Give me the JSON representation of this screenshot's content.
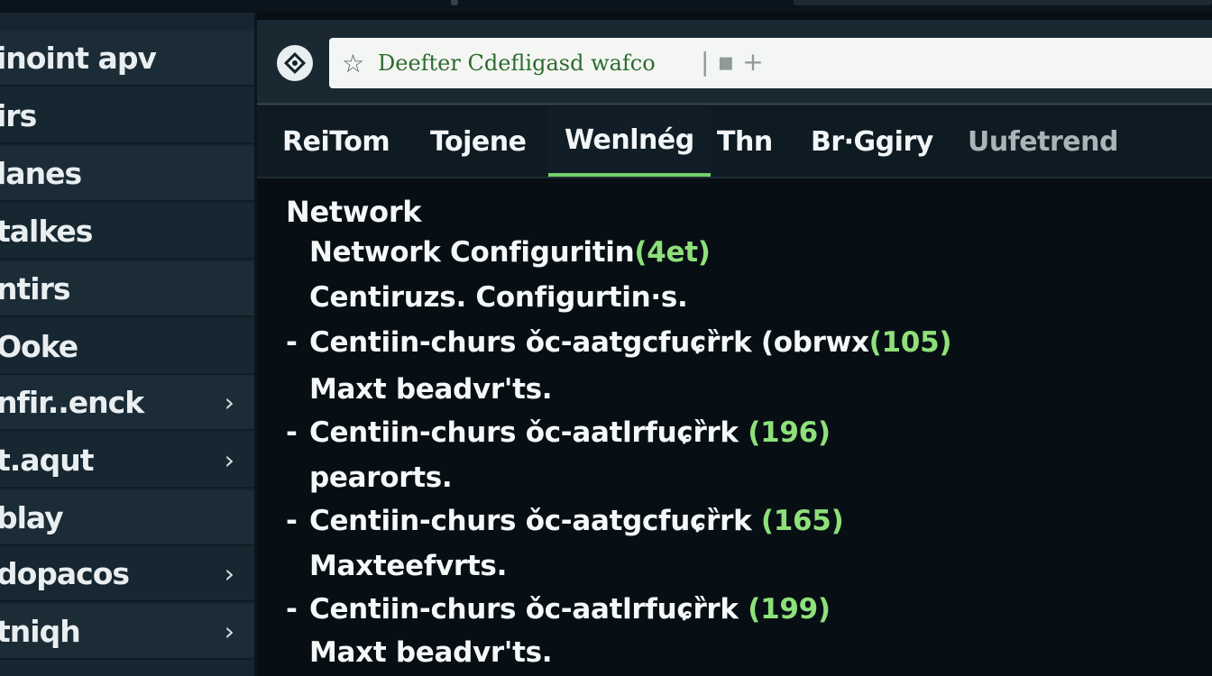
{
  "sidebar": {
    "items": [
      {
        "label": "inoint apv",
        "chevron": false
      },
      {
        "label": "irs",
        "chevron": false
      },
      {
        "label": "lanes",
        "chevron": false
      },
      {
        "label": "talkes",
        "chevron": false
      },
      {
        "label": "ntirs",
        "chevron": false
      },
      {
        "label": "Ooke",
        "chevron": false
      },
      {
        "label": "nfir..enck",
        "chevron": true
      },
      {
        "label": "t.aqut",
        "chevron": true
      },
      {
        "label": "blay",
        "chevron": false
      },
      {
        "label": "dopacos",
        "chevron": true
      },
      {
        "label": "tniqh",
        "chevron": true
      }
    ]
  },
  "address": {
    "url_text": "Deefter Cdefligasd wafco",
    "actions": "| ▪ +"
  },
  "tabs": [
    {
      "label": "ReiTom"
    },
    {
      "label": "Tojene"
    },
    {
      "label": "Wenlnég",
      "active": true
    },
    {
      "label": "Thn"
    },
    {
      "label": "Br·Ggiry"
    },
    {
      "label": "Uufetrend"
    }
  ],
  "content": {
    "heading": "Network",
    "lines": [
      {
        "dash": false,
        "text": "Network Configuritin",
        "count": "(4et)"
      },
      {
        "dash": false,
        "text": "Centiruzs. Configurtin·s.",
        "count": ""
      },
      {
        "dash": true,
        "text": "Centiin-churs ǒc-aatgcfuɕȑrk (obrwx",
        "count": "(105)"
      },
      {
        "dash": false,
        "text": "Maxt beadvr'ts.",
        "count": ""
      },
      {
        "dash": true,
        "text": "Centiin-churs ǒc-aatlrfuɕȑrk",
        "count": "(196)"
      },
      {
        "dash": false,
        "text": "pearorts.",
        "count": ""
      },
      {
        "dash": true,
        "text": "Centiin-churs ǒc-aatgcfuɕȑrk",
        "count": "(165)"
      },
      {
        "dash": false,
        "text": "Maxteefvrts.",
        "count": ""
      },
      {
        "dash": true,
        "text": "Centiin-churs ǒc-aatlrfuɕȑrk",
        "count": "(199)"
      },
      {
        "dash": false,
        "text": "Maxt beadvr'ts.",
        "count": ""
      }
    ]
  },
  "colors": {
    "accent": "#74cf6a",
    "count": "#8ee07a",
    "sidebar_bg": "#1b2c37",
    "main_bg": "#070f15"
  },
  "icons": [
    "site-diamond-icon",
    "star-icon",
    "chevron-right-icon"
  ]
}
